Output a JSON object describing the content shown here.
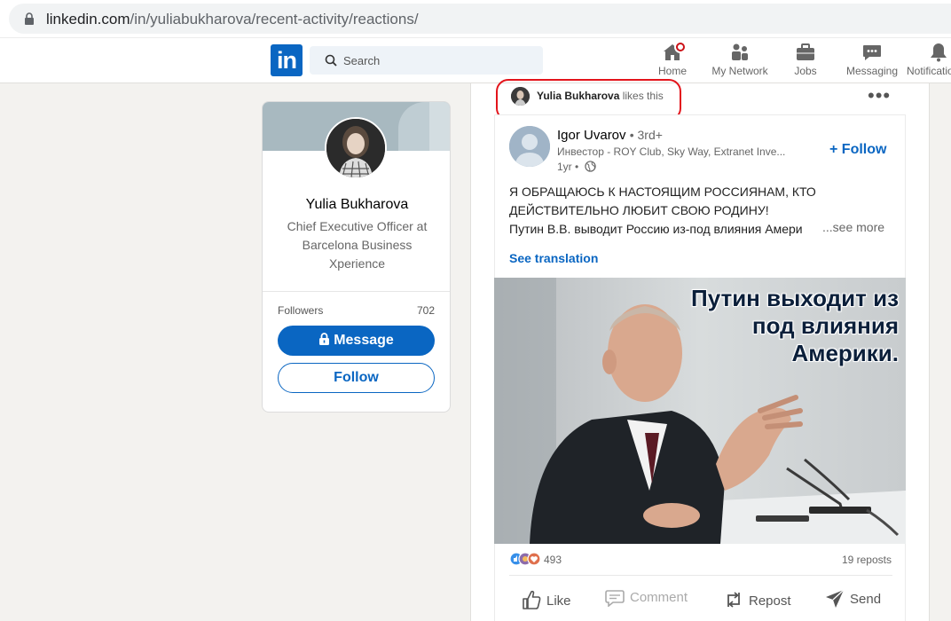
{
  "browser": {
    "url_domain": "linkedin.com",
    "url_path": "/in/yuliabukharova/recent-activity/reactions/"
  },
  "nav": {
    "logo": "in",
    "search_placeholder": "Search",
    "items": [
      {
        "label": "Home",
        "icon": "home-icon"
      },
      {
        "label": "My Network",
        "icon": "network-icon"
      },
      {
        "label": "Jobs",
        "icon": "briefcase-icon"
      },
      {
        "label": "Messaging",
        "icon": "message-icon"
      },
      {
        "label": "Notifications",
        "icon": "bell-icon"
      }
    ]
  },
  "profile": {
    "name": "Yulia Bukharova",
    "title": "Chief Executive Officer at Barcelona Business Xperience",
    "followers_label": "Followers",
    "followers_count": "702",
    "message_label": "Message",
    "follow_label": "Follow"
  },
  "post": {
    "liker_name": "Yulia Bukharova",
    "liker_action": "likes this",
    "more": "•••",
    "author": {
      "name": "Igor Uvarov",
      "degree": "• 3rd+",
      "headline": "Инвестор - ROY Club, Sky Way, Extranet Inve...",
      "time": "1yr •"
    },
    "follow_label": "+ Follow",
    "text_line1": "Я ОБРАЩАЮСЬ К НАСТОЯЩИМ РОССИЯНАМ, КТО",
    "text_line2": "ДЕЙСТВИТЕЛЬНО ЛЮБИТ СВОЮ РОДИНУ!",
    "text_line3": "Путин В.В. выводит Россию из-под влияния Амери",
    "see_more": "...see more",
    "see_translation": "See translation",
    "image_caption_lines": [
      "Путин выходит из",
      "под влияния",
      "Америки."
    ],
    "reaction_count": "493",
    "reposts": "19 reposts",
    "actions": {
      "like": "Like",
      "comment": "Comment",
      "repost": "Repost",
      "send": "Send"
    }
  },
  "colors": {
    "brand_blue": "#0a66c2",
    "highlight_red": "#e3141b",
    "page_bg": "#f3f2ef"
  }
}
